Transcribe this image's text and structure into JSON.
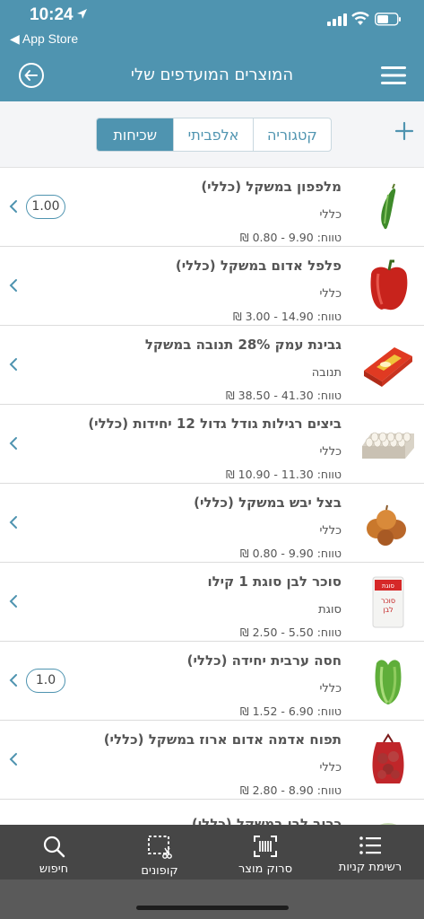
{
  "status_bar": {
    "time": "10:24",
    "back_app": "◀ App Store"
  },
  "header": {
    "title": "המוצרים המועדפים שלי"
  },
  "filter": {
    "tabs": [
      {
        "label": "קטגוריה",
        "active": false
      },
      {
        "label": "אלפביתי",
        "active": false
      },
      {
        "label": "שכיחות",
        "active": true
      }
    ]
  },
  "products": [
    {
      "name": "מלפפון במשקל (כללי)",
      "category": "כללי",
      "range": "טווח: 9.90 - 0.80 ₪",
      "quantity": "1.00",
      "image": "cucumber"
    },
    {
      "name": "פלפל אדום במשקל (כללי)",
      "category": "כללי",
      "range": "טווח: 14.90 - 3.00 ₪",
      "quantity": "",
      "image": "red-pepper"
    },
    {
      "name": "גבינת עמק 28% תנובה במשקל",
      "category": "תנובה",
      "range": "טווח: 41.30 - 38.50 ₪",
      "quantity": "",
      "image": "cheese"
    },
    {
      "name": "ביצים רגילות גודל גדול 12 יחידות (כללי)",
      "category": "כללי",
      "range": "טווח: 11.30 - 10.90 ₪",
      "quantity": "",
      "image": "eggs"
    },
    {
      "name": "בצל יבש במשקל (כללי)",
      "category": "כללי",
      "range": "טווח: 9.90 - 0.80 ₪",
      "quantity": "",
      "image": "onions"
    },
    {
      "name": "סוכר לבן סוגת 1 קילו",
      "category": "סוגת",
      "range": "טווח: 5.50 - 2.50 ₪",
      "quantity": "",
      "image": "sugar"
    },
    {
      "name": "חסה ערבית יחידה (כללי)",
      "category": "כללי",
      "range": "טווח: 6.90 - 1.52 ₪",
      "quantity": "1.0",
      "image": "lettuce"
    },
    {
      "name": "תפוח אדמה אדום ארוז במשקל (כללי)",
      "category": "כללי",
      "range": "טווח: 8.90 - 2.80 ₪",
      "quantity": "",
      "image": "potatoes"
    },
    {
      "name": "כרוב לבן במשקל (כללי)",
      "category": "",
      "range": "",
      "quantity": "",
      "image": "cabbage"
    }
  ],
  "sugar_pack_text": {
    "brand": "סוגת",
    "line1": "סוכר",
    "line2": "לבן"
  },
  "tabbar": {
    "search": "חיפוש",
    "coupons": "קופונים",
    "scan": "סרוק מוצר",
    "list": "רשימת קניות"
  }
}
